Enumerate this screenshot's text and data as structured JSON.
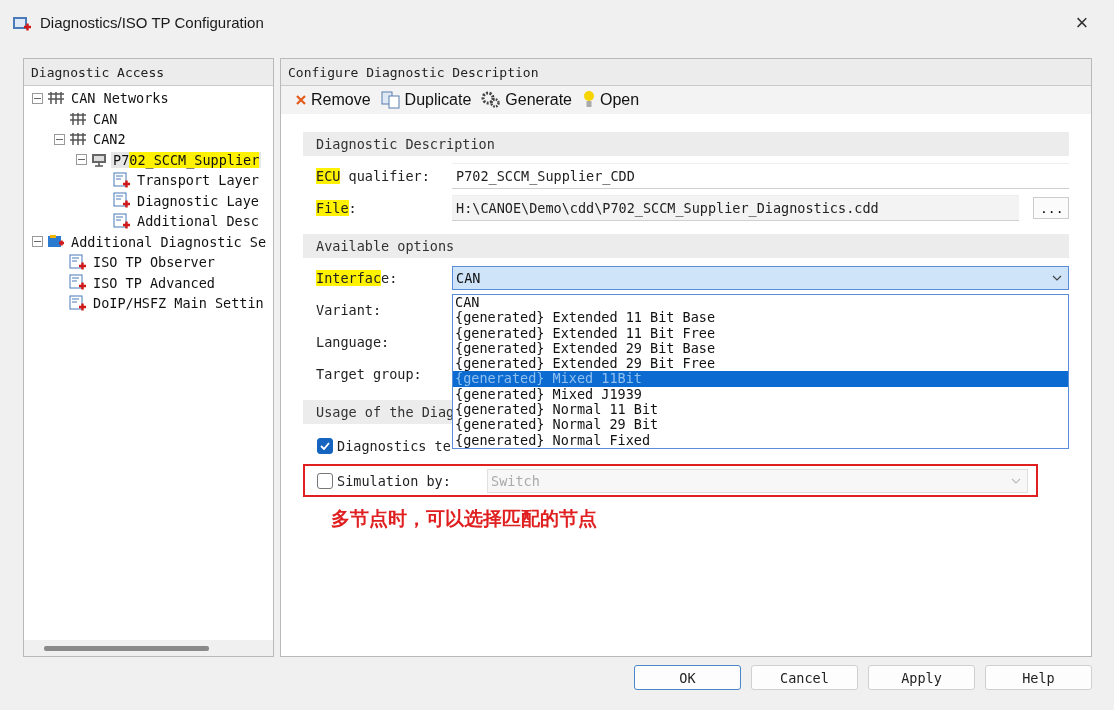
{
  "window": {
    "title": "Diagnostics/ISO TP Configuration",
    "close": "×"
  },
  "left_panel": {
    "title": "Diagnostic Access",
    "tree": [
      {
        "parts": [
          {
            "text": "CAN Networks",
            "highlighted": false
          }
        ],
        "kind": "network",
        "expanded": true,
        "children": [
          {
            "parts": [
              {
                "text": "CAN",
                "highlighted": false
              }
            ],
            "kind": "network"
          },
          {
            "parts": [
              {
                "text": "CAN2",
                "highlighted": false
              }
            ],
            "kind": "network",
            "expanded": true,
            "children": [
              {
                "parts": [
                  {
                    "text": "P7",
                    "highlighted": false
                  },
                  {
                    "text": "02_SCCM_Supplier",
                    "highlighted": true
                  }
                ],
                "kind": "node",
                "expanded": true,
                "selected": true,
                "children": [
                  {
                    "parts": [
                      {
                        "text": "Transport Layer",
                        "highlighted": false
                      }
                    ],
                    "kind": "config"
                  },
                  {
                    "parts": [
                      {
                        "text": "Diagnostic Laye",
                        "highlighted": false
                      }
                    ],
                    "kind": "config"
                  },
                  {
                    "parts": [
                      {
                        "text": "Additional Desc",
                        "highlighted": false
                      }
                    ],
                    "kind": "config"
                  }
                ]
              }
            ]
          }
        ]
      },
      {
        "parts": [
          {
            "text": "Additional Diagnostic Se",
            "highlighted": false
          }
        ],
        "kind": "folder",
        "expanded": true,
        "children": [
          {
            "parts": [
              {
                "text": "ISO TP Observer",
                "highlighted": false
              }
            ],
            "kind": "config"
          },
          {
            "parts": [
              {
                "text": "ISO TP Advanced",
                "highlighted": false
              }
            ],
            "kind": "config"
          },
          {
            "parts": [
              {
                "text": "DoIP/HSFZ Main Settin",
                "highlighted": false
              }
            ],
            "kind": "config"
          }
        ]
      }
    ]
  },
  "right_panel": {
    "title": "Configure Diagnostic Description",
    "toolbar": [
      {
        "label": "Remove",
        "kind": "remove"
      },
      {
        "label": "Duplicate",
        "kind": "duplicate"
      },
      {
        "label": "Generate",
        "kind": "generate"
      },
      {
        "label": "Open",
        "kind": "open"
      }
    ],
    "sections": [
      {
        "title": "Diagnostic Description",
        "rows": [
          {
            "kind": "text",
            "label": [
              {
                "text": "ECU",
                "highlighted": true
              },
              {
                "text": " qualifier:",
                "highlighted": false
              }
            ],
            "value": "P702_SCCM_Supplier_CDD"
          },
          {
            "kind": "file",
            "label": [
              {
                "text": "File",
                "highlighted": true
              },
              {
                "text": ":",
                "highlighted": false
              }
            ],
            "value": "H:\\CANOE\\Demo\\cdd\\P702_SCCM_Supplier_Diagnostics.cdd",
            "button": "..."
          }
        ]
      },
      {
        "title": "Available options",
        "rows": [
          {
            "kind": "combo",
            "label": [
              {
                "text": "Interfac",
                "highlighted": true
              },
              {
                "text": "e:",
                "highlighted": false
              }
            ],
            "value": "CAN",
            "open": true,
            "options": [
              {
                "label": "CAN",
                "highlighted": false
              },
              {
                "label": "{generated} Extended 11 Bit Base",
                "highlighted": false
              },
              {
                "label": "{generated} Extended 11 Bit Free",
                "highlighted": false
              },
              {
                "label": "{generated} Extended 29 Bit Base",
                "highlighted": false
              },
              {
                "label": "{generated} Extended 29 Bit Free",
                "highlighted": false
              },
              {
                "label": "{generated} Mixed 11Bit",
                "highlighted": true
              },
              {
                "label": "{generated} Mixed J1939",
                "highlighted": false
              },
              {
                "label": "{generated} Normal 11 Bit",
                "highlighted": false
              },
              {
                "label": "{generated} Normal 29 Bit",
                "highlighted": false
              },
              {
                "label": "{generated} Normal Fixed",
                "highlighted": false
              }
            ]
          },
          {
            "kind": "hidden",
            "label": [
              {
                "text": "Variant:",
                "highlighted": false
              }
            ]
          },
          {
            "kind": "hidden",
            "label": [
              {
                "text": "Language:",
                "highlighted": false
              }
            ]
          },
          {
            "kind": "hidden",
            "label": [
              {
                "text": "Target group:",
                "highlighted": false
              }
            ]
          }
        ]
      },
      {
        "title": "Usage of the Diag",
        "rows": [
          {
            "kind": "check",
            "label": [
              {
                "text": "Diagnostics te",
                "highlighted": false
              }
            ],
            "checked": true
          },
          {
            "kind": "check",
            "label": [
              {
                "text": "Simulation by:",
                "highlighted": false
              }
            ],
            "checked": false,
            "value": "Switch",
            "disabled": true,
            "boxed": true
          }
        ]
      }
    ],
    "annotation": "多节点时，可以选择匹配的节点"
  },
  "buttons": [
    {
      "label": "OK",
      "default": true
    },
    {
      "label": "Cancel",
      "default": false
    },
    {
      "label": "Apply",
      "default": false
    },
    {
      "label": "Help",
      "default": false
    }
  ]
}
